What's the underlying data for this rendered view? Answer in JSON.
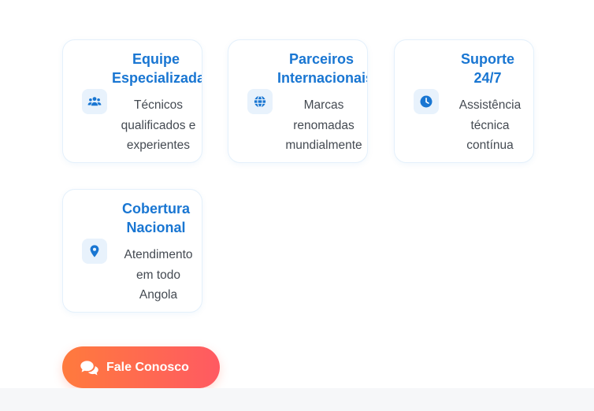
{
  "features": [
    {
      "icon": "users-icon",
      "title_lines": [
        "Equipe",
        "Especializada"
      ],
      "text_lines": [
        "Técnicos",
        "qualificados e",
        "experientes"
      ]
    },
    {
      "icon": "globe-icon",
      "title_lines": [
        "Parceiros",
        "Internacionais"
      ],
      "text_lines": [
        "Marcas",
        "renomadas",
        "mundialmente"
      ]
    },
    {
      "icon": "clock-icon",
      "title_lines": [
        "Suporte",
        "24/7"
      ],
      "text_lines": [
        "Assistência",
        "técnica",
        "contínua"
      ]
    },
    {
      "icon": "map-pin-icon",
      "title_lines": [
        "Cobertura",
        "Nacional"
      ],
      "text_lines": [
        "Atendimento",
        "em todo",
        "Angola"
      ]
    }
  ],
  "cta": {
    "icon": "chat-bubbles-icon",
    "label": "Fale Conosco"
  },
  "colors": {
    "accent": "#1976d2",
    "icon_bg": "#e8f2fc",
    "cta_gradient_start": "#ff7a3d",
    "cta_gradient_end": "#ff5a62"
  }
}
